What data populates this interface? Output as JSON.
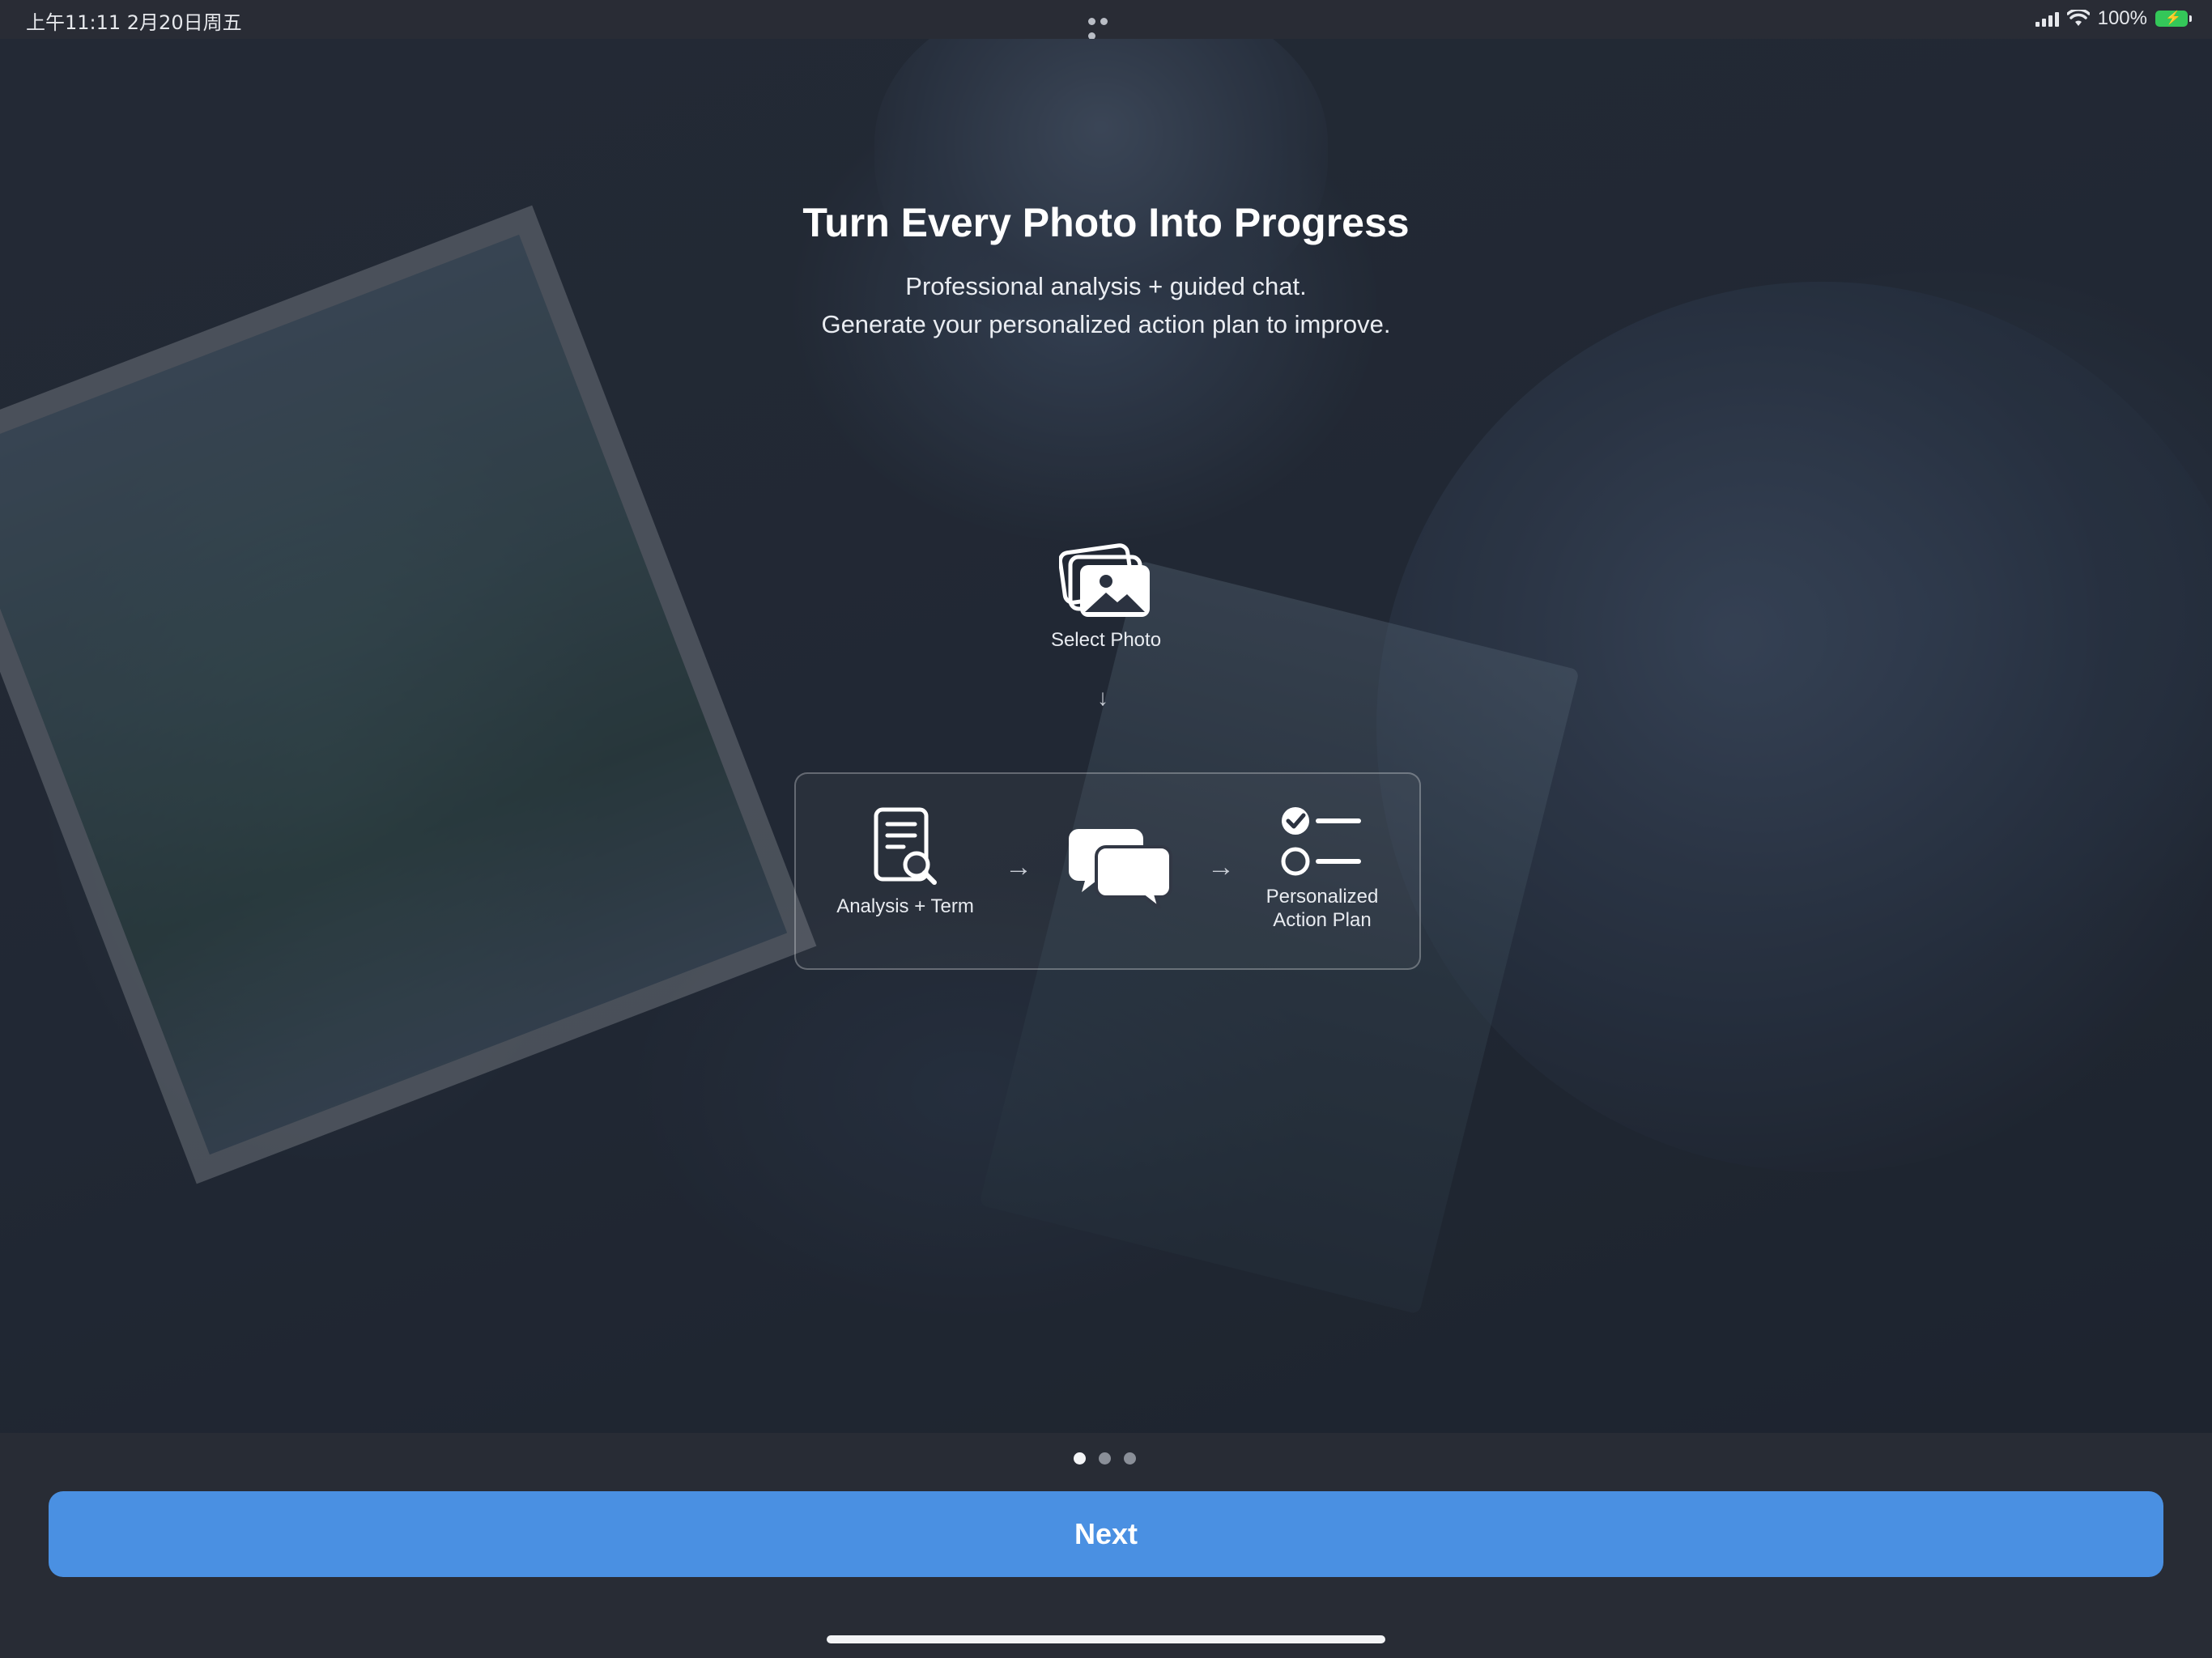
{
  "status_bar": {
    "time": "上午11:11   2月20日周五",
    "battery": "100%"
  },
  "hero": {
    "title": "Turn Every Photo Into Progress",
    "subtitle_line1": "Professional analysis + guided chat.",
    "subtitle_line2": "Generate your personalized action plan to improve."
  },
  "workflow": {
    "select_photo": "Select Photo",
    "analysis": "Analysis + Term",
    "plan_line1": "Personalized",
    "plan_line2": "Action Plan",
    "down_arrow": "↓",
    "right_arrow": "→"
  },
  "pager": {
    "count": 3,
    "active": 1
  },
  "buttons": {
    "next": "Next"
  },
  "colors": {
    "accent": "#4a90e2",
    "background": "#282c35",
    "battery": "#34c759"
  }
}
